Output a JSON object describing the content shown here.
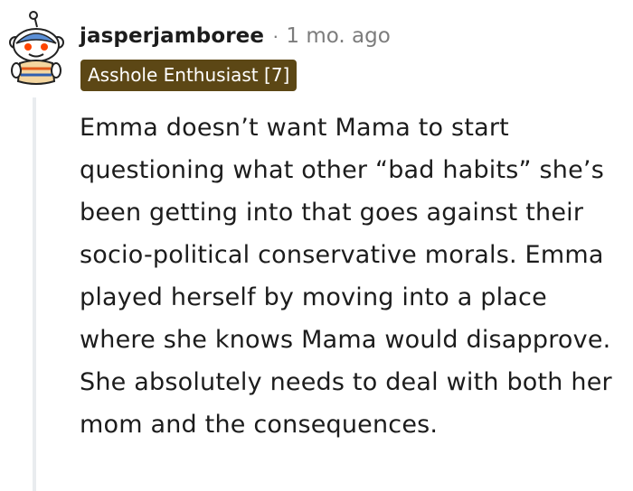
{
  "comment": {
    "author": {
      "username": "jasperjamboree",
      "avatar_icon": "reddit-snoo-avatar-icon"
    },
    "separator": "·",
    "timestamp": "1 mo. ago",
    "flair": {
      "text": "Asshole Enthusiast [7]",
      "background_color": "#5c4715",
      "text_color": "#ffffff"
    },
    "body": "Emma doesn’t want Mama to start questioning what other “bad habits” she’s been getting into that goes against their socio-political conservative morals. Emma played herself by moving into a place where she knows Mama would disapprove. She absolutely needs to deal with both her mom and the consequences."
  },
  "colors": {
    "text": "#1c1c1c",
    "meta": "#7c7c7c",
    "thread_line": "#e9ecef"
  }
}
